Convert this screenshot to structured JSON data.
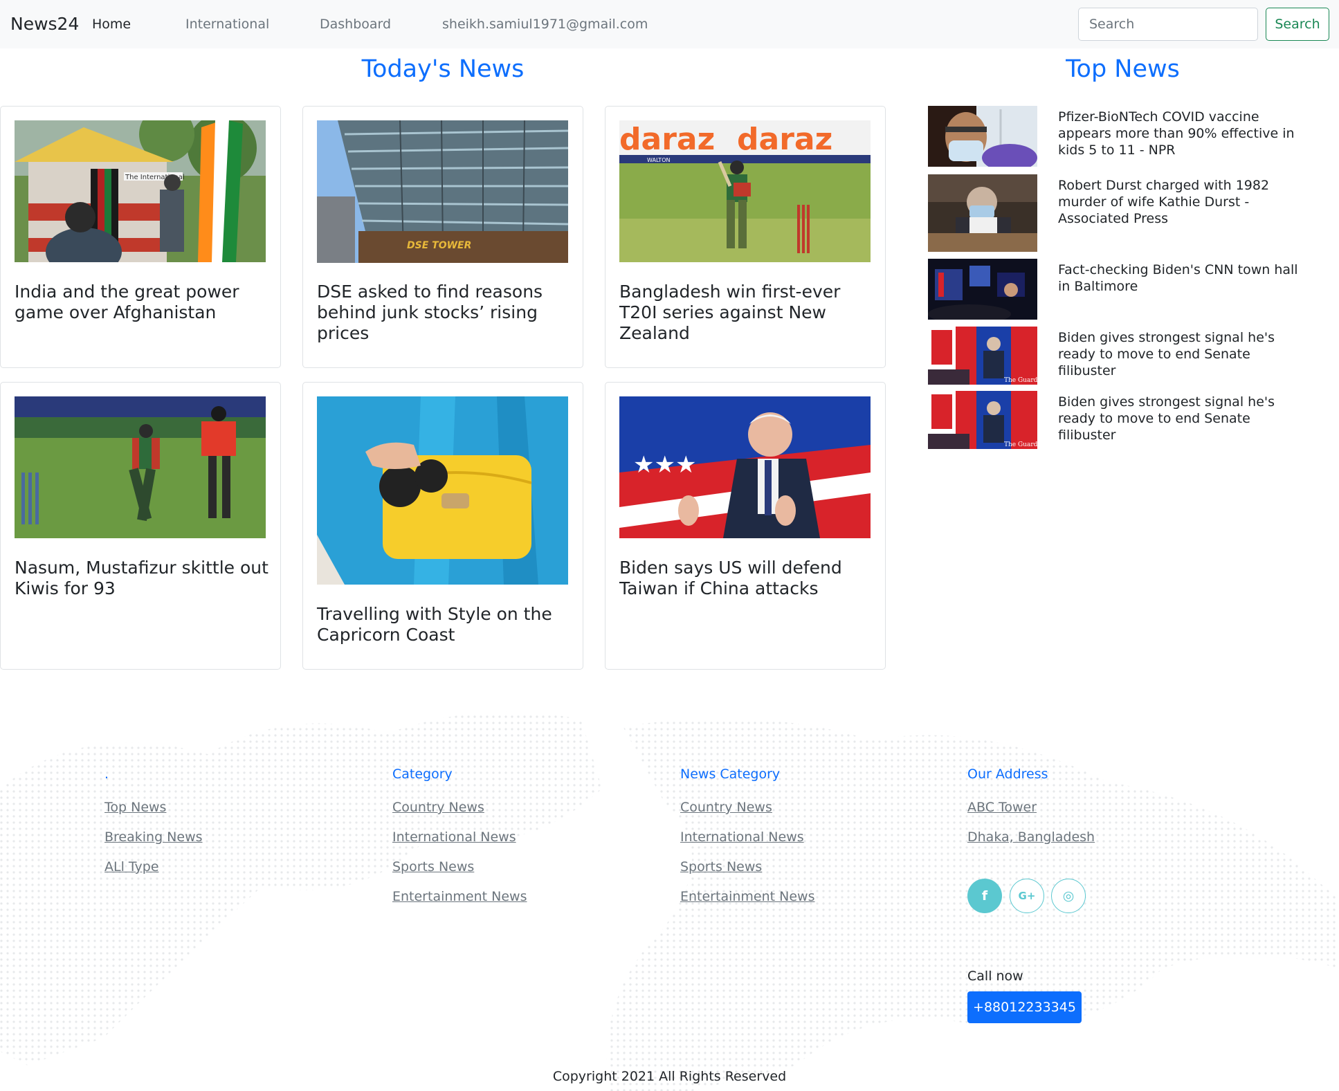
{
  "navbar": {
    "brand": "News24",
    "links": [
      "Home",
      "International",
      "Dashboard",
      "sheikh.samiul1971@gmail.com"
    ],
    "search_placeholder": "Search",
    "search_button": "Search"
  },
  "todays_news": {
    "title": "Today's News",
    "cards": [
      {
        "title": "India and the great power game over Afghanistan"
      },
      {
        "title": "DSE asked to find reasons behind junk stocks’ rising prices"
      },
      {
        "title": "Bangladesh win first-ever T20I series against New Zealand"
      },
      {
        "title": "Nasum, Mustafizur skittle out Kiwis for 93"
      },
      {
        "title": "Travelling with Style on the Capricorn Coast"
      },
      {
        "title": "Biden says US will defend Taiwan if China attacks"
      }
    ],
    "image_text": {
      "afghan_sign": "The International",
      "dse_sign": "DSE TOWER",
      "daraz": "daraz",
      "walton": "WALTON",
      "guardian": "The Guardian"
    }
  },
  "top_news": {
    "title": "Top News",
    "items": [
      {
        "title": "Pfizer-BioNTech COVID vaccine appears more than 90% effective in kids 5 to 11 - NPR"
      },
      {
        "title": "Robert Durst charged with 1982 murder of wife Kathie Durst - Associated Press"
      },
      {
        "title": "Fact-checking Biden's CNN town hall in Baltimore"
      },
      {
        "title": "Biden gives strongest signal he's ready to move to end Senate filibuster"
      },
      {
        "title": "Biden gives strongest signal he's ready to move to end Senate filibuster"
      }
    ]
  },
  "footer": {
    "col1": {
      "heading": ".",
      "links": [
        "Top News",
        "Breaking News",
        "ALl Type"
      ]
    },
    "col2": {
      "heading": "Category",
      "links": [
        "Country News",
        "International News",
        "Sports News",
        "Entertainment News"
      ]
    },
    "col3": {
      "heading": "News Category",
      "links": [
        "Country News",
        "International News",
        "Sports News",
        "Entertainment News"
      ]
    },
    "col4": {
      "heading": "Our Address",
      "links": [
        "ABC Tower",
        "Dhaka, Bangladesh"
      ]
    },
    "social": {
      "facebook": "f",
      "google_plus": "G+",
      "instagram": "◎"
    },
    "call_label": "Call now",
    "phone": "+88012233345",
    "copyright": "Copyright 2021 All Rights Reserved"
  },
  "colors": {
    "accent": "#0d6efd",
    "success": "#198754",
    "teal": "#5bc8d0"
  }
}
